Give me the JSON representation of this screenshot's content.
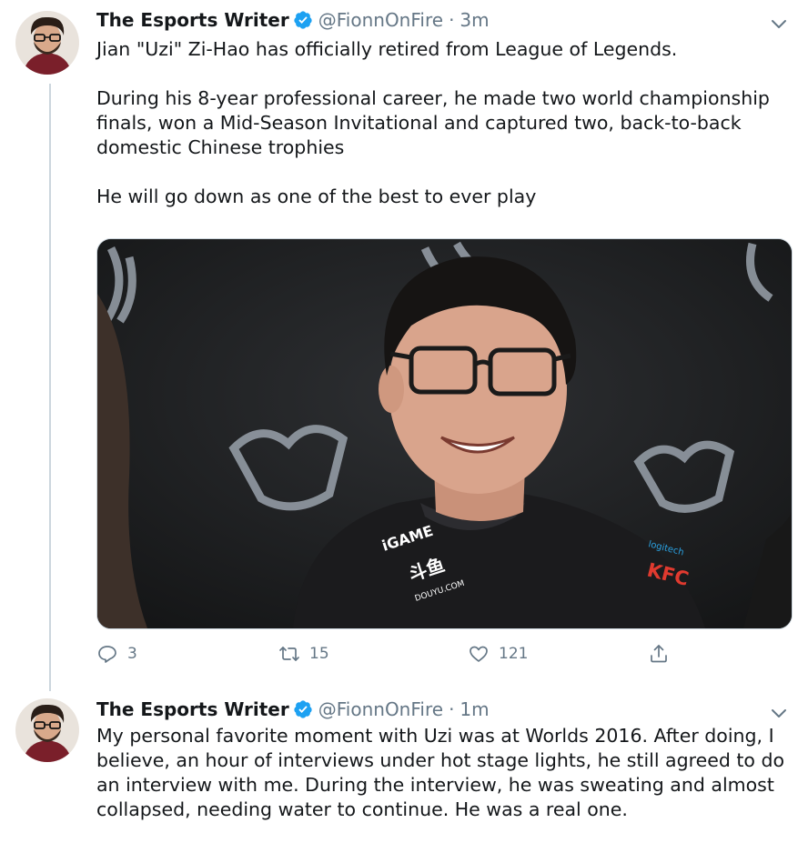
{
  "tweets": [
    {
      "author_name": "The Esports Writer",
      "handle": "@FionnOnFire",
      "separator": "·",
      "time": "3m",
      "text": "Jian \"Uzi\" Zi-Hao has officially retired from League of Legends.\n\nDuring his 8-year professional career, he made two world championship finals, won a Mid-Season Invitational and captured two, back-to-back domestic Chinese trophies\n\nHe will go down as one of the best to ever play",
      "media": {
        "jersey_sponsors": [
          "iGAME",
          "斗鱼",
          "DOUYU.COM",
          "KFC",
          "logitech"
        ]
      },
      "actions": {
        "replies": "3",
        "retweets": "15",
        "likes": "121"
      }
    },
    {
      "author_name": "The Esports Writer",
      "handle": "@FionnOnFire",
      "separator": "·",
      "time": "1m",
      "text": "My personal favorite moment with Uzi was at Worlds 2016. After doing, I believe, an hour of interviews under hot stage lights, he still agreed to do an interview with me. During the interview, he was sweating and almost collapsed, needing water to continue. He was a real one."
    }
  ],
  "icons": {
    "verified": "verified-badge-icon",
    "caret": "chevron-down-icon",
    "reply": "reply-icon",
    "retweet": "retweet-icon",
    "like": "heart-icon",
    "share": "share-icon"
  },
  "colors": {
    "verified": "#1da1f2",
    "muted": "#657786",
    "text": "#14171a",
    "thread_line": "#ccd6dd"
  }
}
